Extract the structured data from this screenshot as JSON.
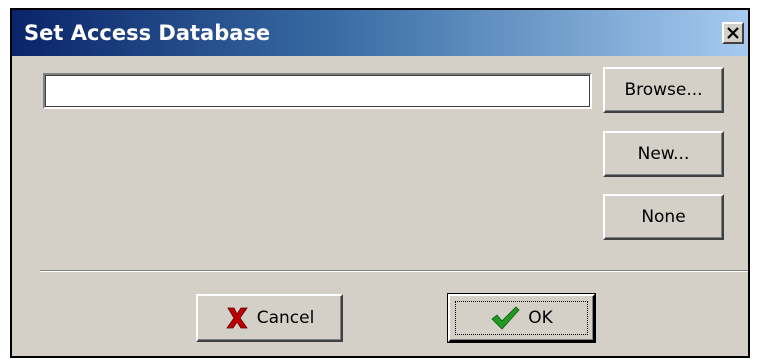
{
  "dialog": {
    "title": "Set Access Database"
  },
  "path_field": {
    "value": "",
    "placeholder": ""
  },
  "buttons": {
    "browse": "Browse...",
    "new": "New...",
    "none": "None",
    "cancel": "Cancel",
    "ok": "OK"
  },
  "icons": {
    "close": "close-icon",
    "cancel": "red-x-icon",
    "ok": "green-checkmark-icon"
  },
  "colors": {
    "title_gradient_start": "#0a246a",
    "title_gradient_end": "#a6caf0",
    "dialog_face": "#d4d0c8",
    "cancel_icon": "#c00000",
    "ok_icon": "#1f9a1f"
  }
}
